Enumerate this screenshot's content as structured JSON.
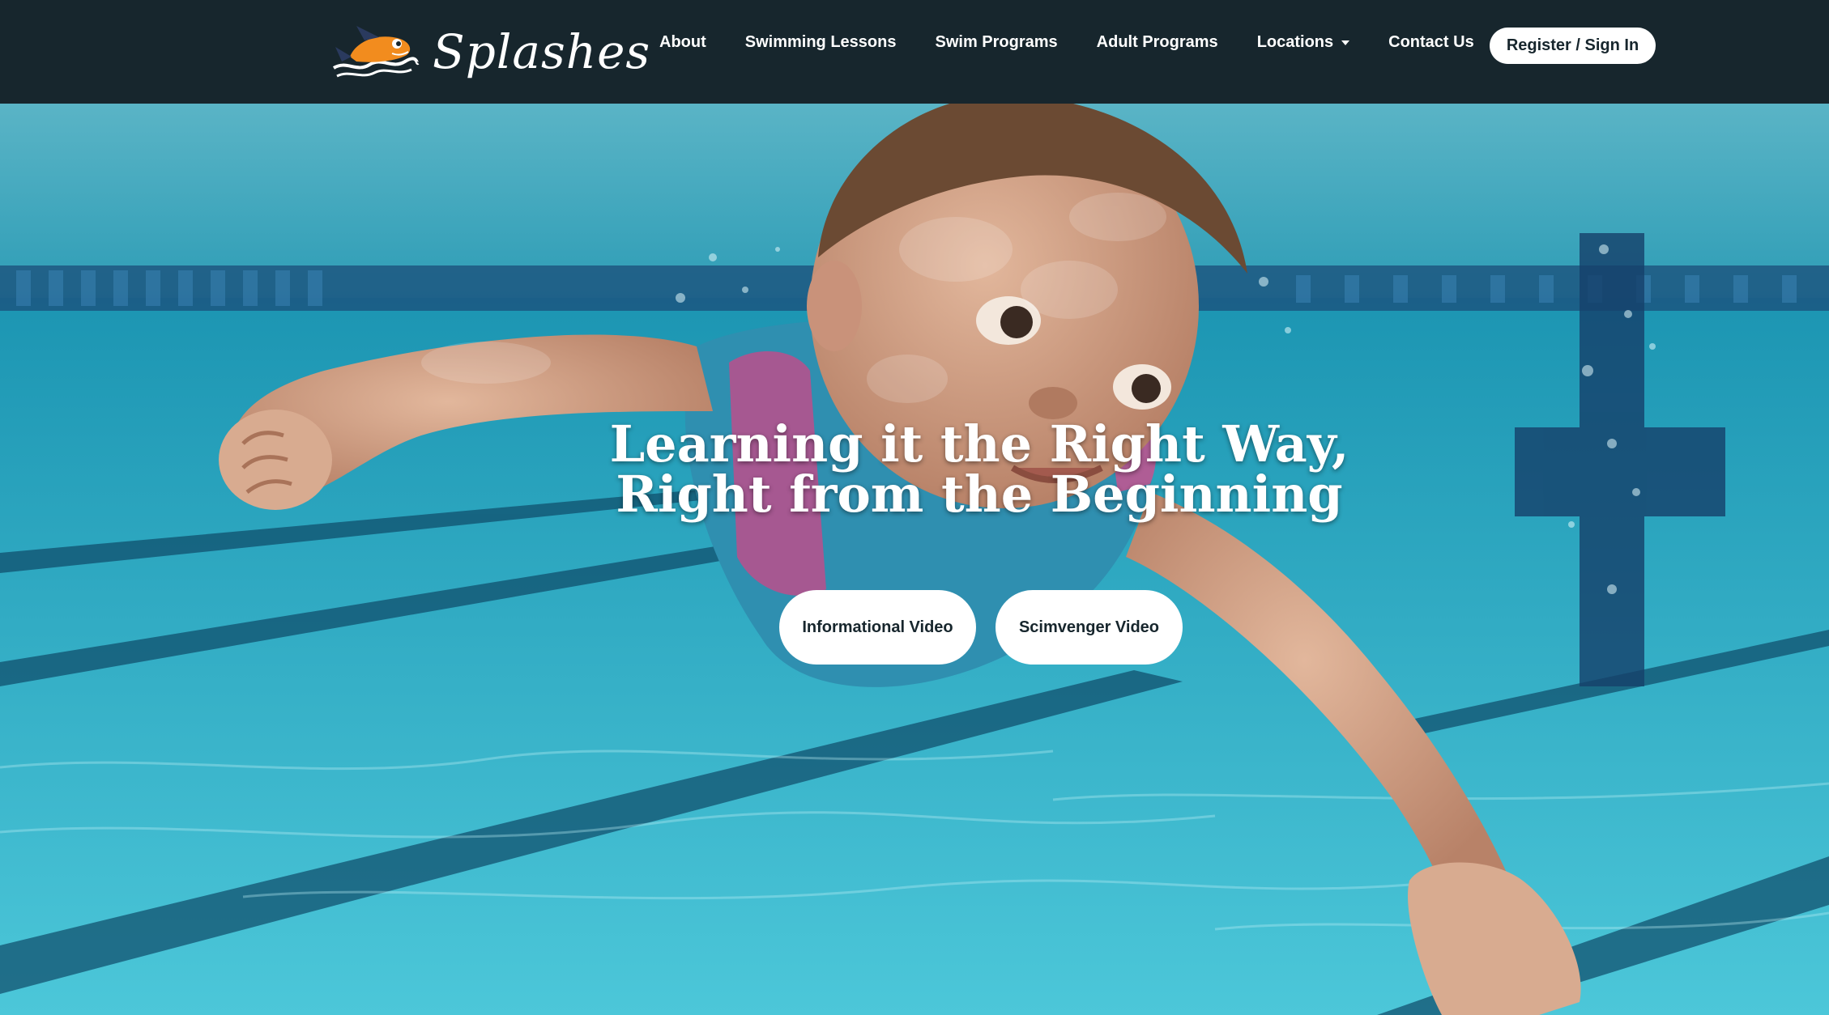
{
  "brand": {
    "name": "Splashes",
    "mascot_icon": "shark-mascot-icon"
  },
  "nav": {
    "items": [
      {
        "label": "About"
      },
      {
        "label": "Swimming Lessons"
      },
      {
        "label": "Swim Programs"
      },
      {
        "label": "Adult Programs"
      },
      {
        "label": "Locations",
        "dropdown": true
      },
      {
        "label": "Contact Us"
      }
    ],
    "register_label": "Register / Sign In"
  },
  "hero": {
    "title_line1": "Learning it the Right Way,",
    "title_line2": "Right from the Beginning",
    "buttons": {
      "informational": "Informational Video",
      "scimvenger": "Scimvenger Video"
    },
    "image": "underwater-child-swimming-photo"
  },
  "colors": {
    "navbar": "#17262d",
    "button_bg": "#ffffff",
    "button_text": "#17262d",
    "pool_water": "#19a9c6"
  }
}
